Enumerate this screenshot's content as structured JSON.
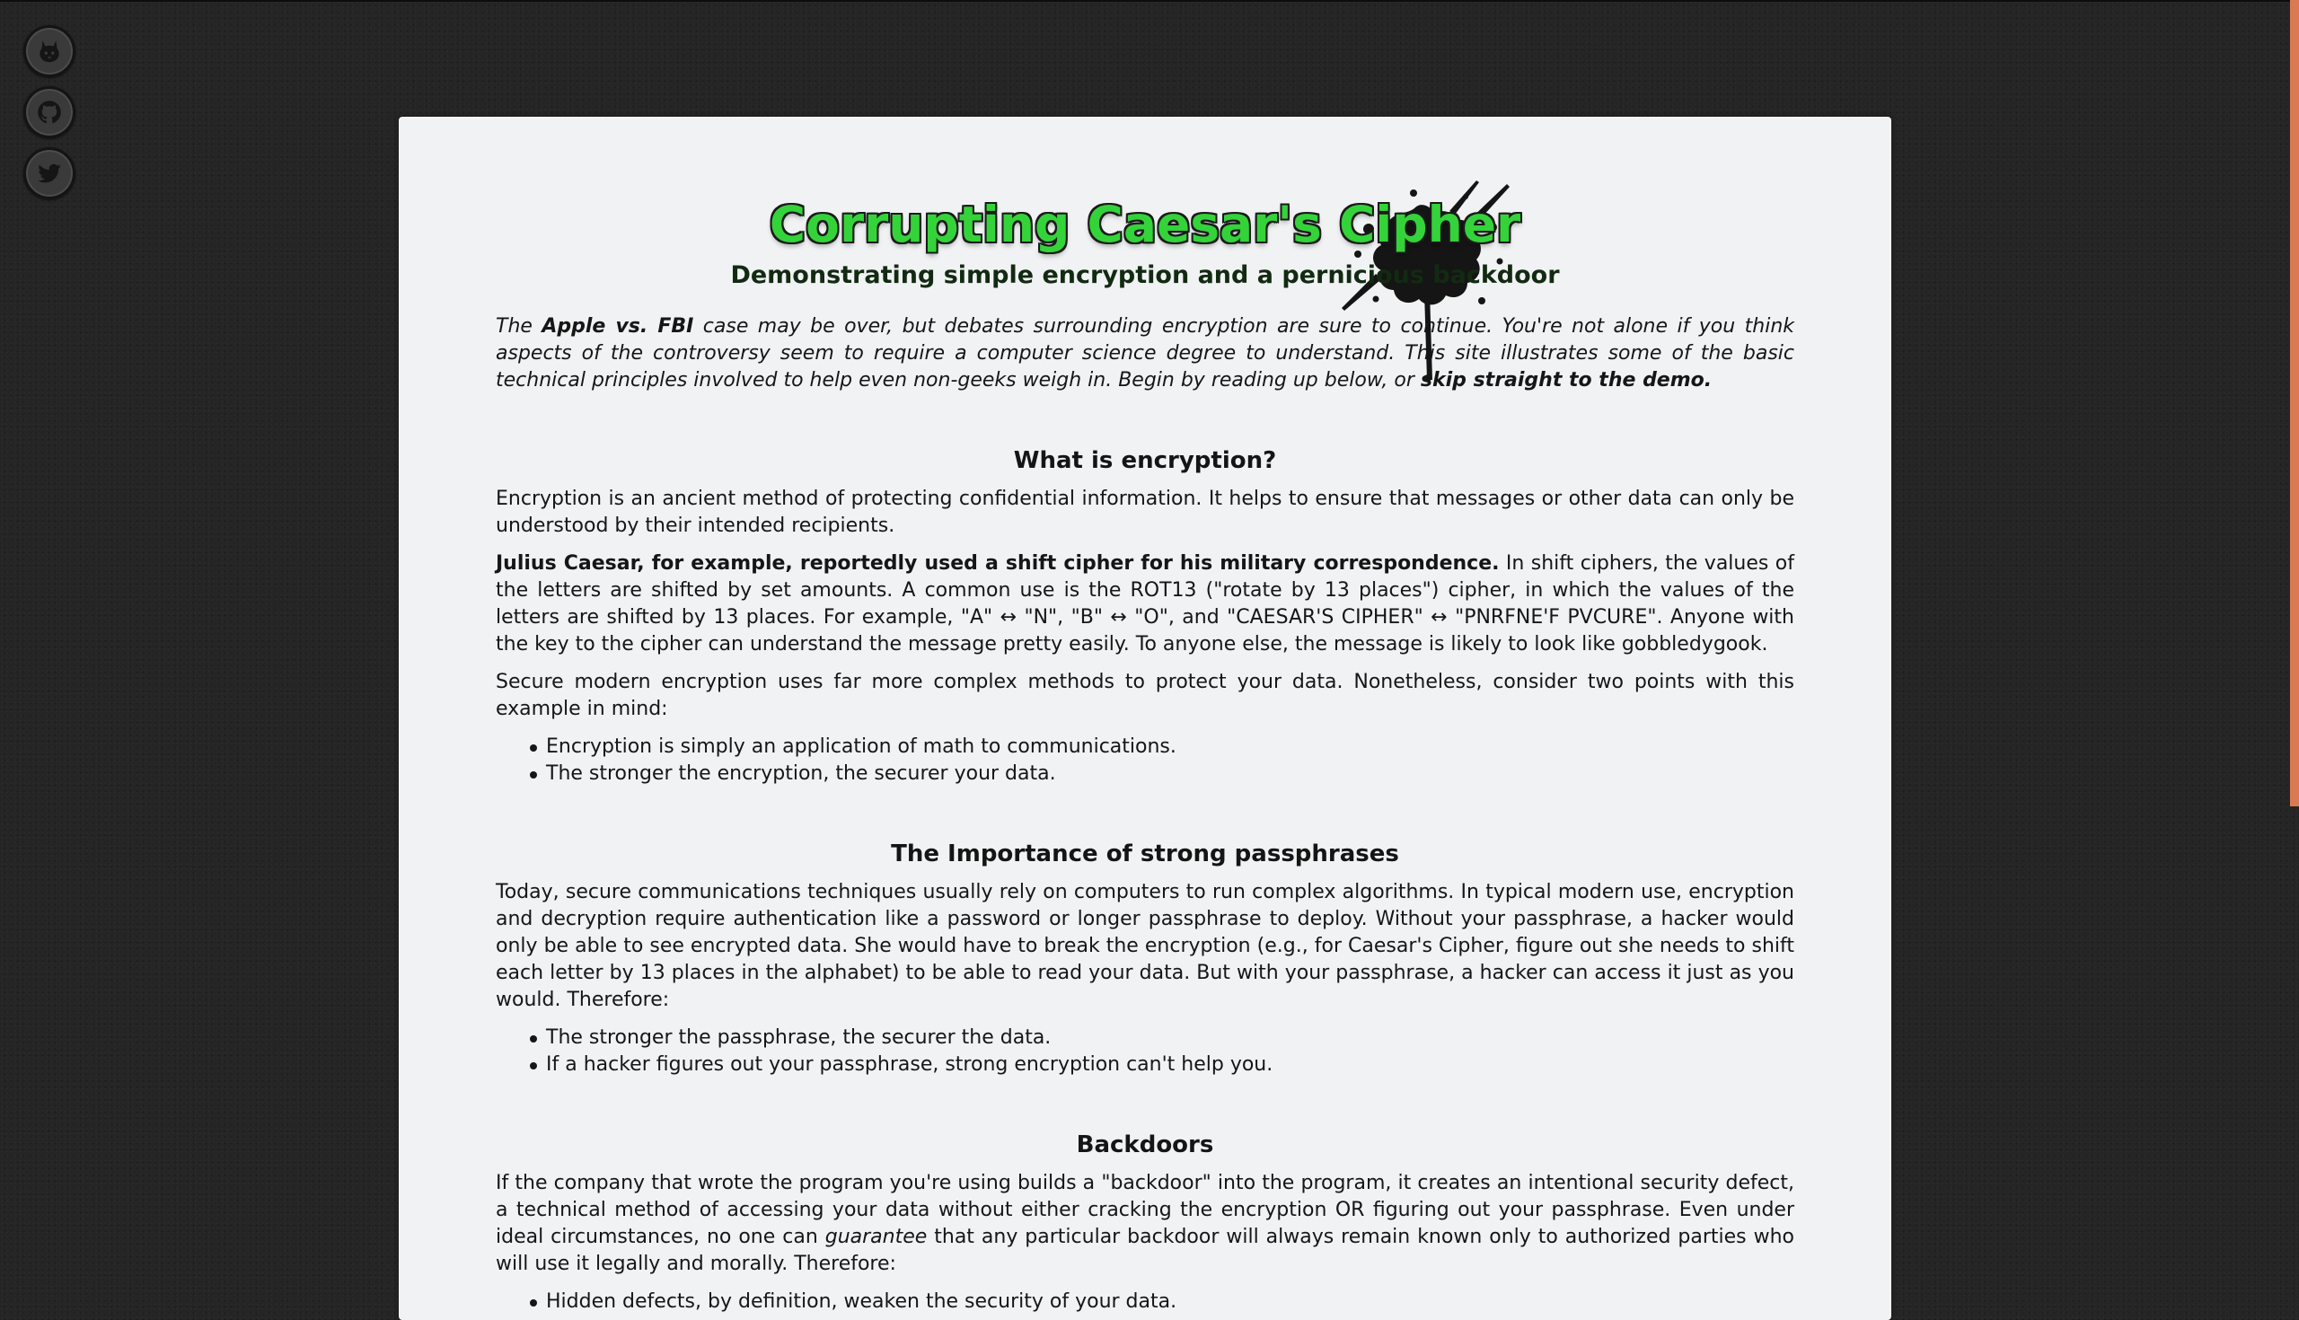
{
  "social": {
    "items": [
      {
        "icon": "cat-icon"
      },
      {
        "icon": "github-icon"
      },
      {
        "icon": "twitter-icon"
      }
    ]
  },
  "article": {
    "title": "Corrupting Caesar's Cipher",
    "subtitle": "Demonstrating simple encryption and a pernicious backdoor",
    "intro": {
      "t1": "The ",
      "b1": "Apple vs. FBI",
      "t2": " case may be over, but debates surrounding encryption are sure to continue. You're not alone if you think aspects of the controversy seem to require a computer science degree to understand. This site illustrates some of the basic technical principles involved to help even non-geeks weigh in. Begin by reading up below, or ",
      "link": "skip straight to the demo.",
      "t3": ""
    },
    "sections": {
      "encryption": {
        "heading": "What is encryption?",
        "p1": "Encryption is an ancient method of protecting confidential information. It helps to ensure that messages or other data can only be understood by their intended recipients.",
        "p2_bold": "Julius Caesar, for example, reportedly used a shift cipher for his military correspondence.",
        "p2_rest": " In shift ciphers, the values of the letters are shifted by set amounts. A common use is the ROT13 (\"rotate by 13 places\") cipher, in which the values of the letters are shifted by 13 places. For example, \"A\" ↔ \"N\", \"B\" ↔ \"O\", and \"CAESAR'S CIPHER\" ↔ \"PNRFNE'F PVCURE\". Anyone with the key to the cipher can understand the message pretty easily. To anyone else, the message is likely to look like gobbledygook.",
        "p3": "Secure modern encryption uses far more complex methods to protect your data. Nonetheless, consider two points with this example in mind:",
        "bullets": [
          "Encryption is simply an application of math to communications.",
          "The stronger the encryption, the securer your data."
        ]
      },
      "passphrases": {
        "heading": "The Importance of strong passphrases",
        "p1": "Today, secure communications techniques usually rely on computers to run complex algorithms. In typical modern use, encryption and decryption require authentication like a password or longer passphrase to deploy. Without your passphrase, a hacker would only be able to see encrypted data. She would have to break the encryption (e.g., for Caesar's Cipher, figure out she needs to shift each letter by 13 places in the alphabet) to be able to read your data. But with your passphrase, a hacker can access it just as you would. Therefore:",
        "bullets": [
          "The stronger the passphrase, the securer the data.",
          "If a hacker figures out your passphrase, strong encryption can't help you."
        ]
      },
      "backdoors": {
        "heading": "Backdoors",
        "p1_a": "If the company that wrote the program you're using builds a \"backdoor\" into the program, it creates an intentional security defect, a technical method of accessing your data without either cracking the encryption OR figuring out your passphrase. Even under ideal circumstances, no one can ",
        "p1_em": "guarantee",
        "p1_b": " that any particular backdoor will always remain known only to authorized parties who will use it legally and morally. Therefore:",
        "bullets": [
          "Hidden defects, by definition, weaken the security of your data."
        ]
      }
    }
  },
  "colors": {
    "page_bg": "#252525",
    "card_bg": "#f1f2f3",
    "title_green": "#34d33a",
    "accent": "#d97a55"
  }
}
